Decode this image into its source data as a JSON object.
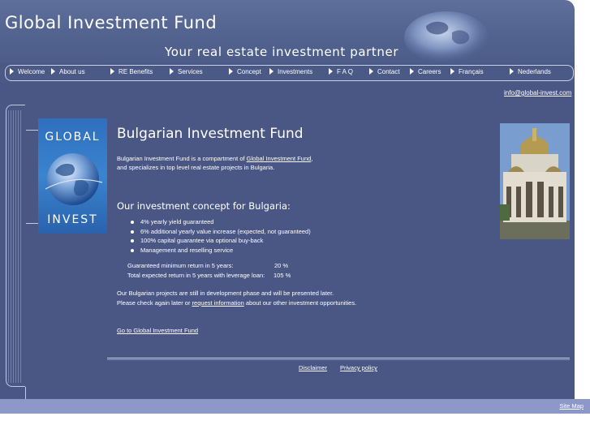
{
  "header": {
    "title": "Global Investment Fund",
    "tagline": "Your real estate investment partner"
  },
  "nav": {
    "items": [
      {
        "label": "Welcome"
      },
      {
        "label": "About us"
      },
      {
        "label": "RE Benefits"
      },
      {
        "label": "Services"
      },
      {
        "label": "Concept"
      },
      {
        "label": "Investments"
      },
      {
        "label": "F A Q"
      },
      {
        "label": "Contact"
      },
      {
        "label": "Careers"
      },
      {
        "label": "Français"
      },
      {
        "label": "Nederlands"
      }
    ]
  },
  "contact": {
    "email": "info@global-invest.com"
  },
  "logo": {
    "top_word": "GLOBAL",
    "bottom_word": "INVEST"
  },
  "main": {
    "title": "Bulgarian Investment Fund",
    "intro_line1_prefix": "Bulgarian Investment Fund is a compartment of ",
    "intro_link": "Global Investment Fund",
    "intro_line1_suffix": ",",
    "intro_line2": "and specializes in top level real estate projects in Bulgaria.",
    "concept_title": "Our investment concept for Bulgaria:",
    "bullets": [
      "4% yearly yield guaranteed",
      "6% additional yearly value increase (expected, not guaranteed)",
      "100% capital guarantee via optional buy-back",
      "Management and reselling service"
    ],
    "returns": [
      {
        "label": "Guaranteed minimum return in 5 years:",
        "value": "20 %"
      },
      {
        "label": "Total expected return in 5 years with leverage loan:",
        "value": "105 %"
      }
    ],
    "status_line1": "Our Bulgarian projects are still in development phase and will be presented later.",
    "status_line2_prefix": "Please check again later or ",
    "status_link": "request information",
    "status_line2_suffix": " about our other investment opportunities.",
    "goto_link": "Go to Global Investment Fund"
  },
  "footer": {
    "disclaimer": "Disclaimer",
    "privacy": "Privacy policy",
    "site_map": "Site Map"
  },
  "colors": {
    "header_bg": "#5f6f9b",
    "body_bg": "#4a5785",
    "bottom_bar": "#8e98c8",
    "logo_blue": "#2f6fbe"
  }
}
